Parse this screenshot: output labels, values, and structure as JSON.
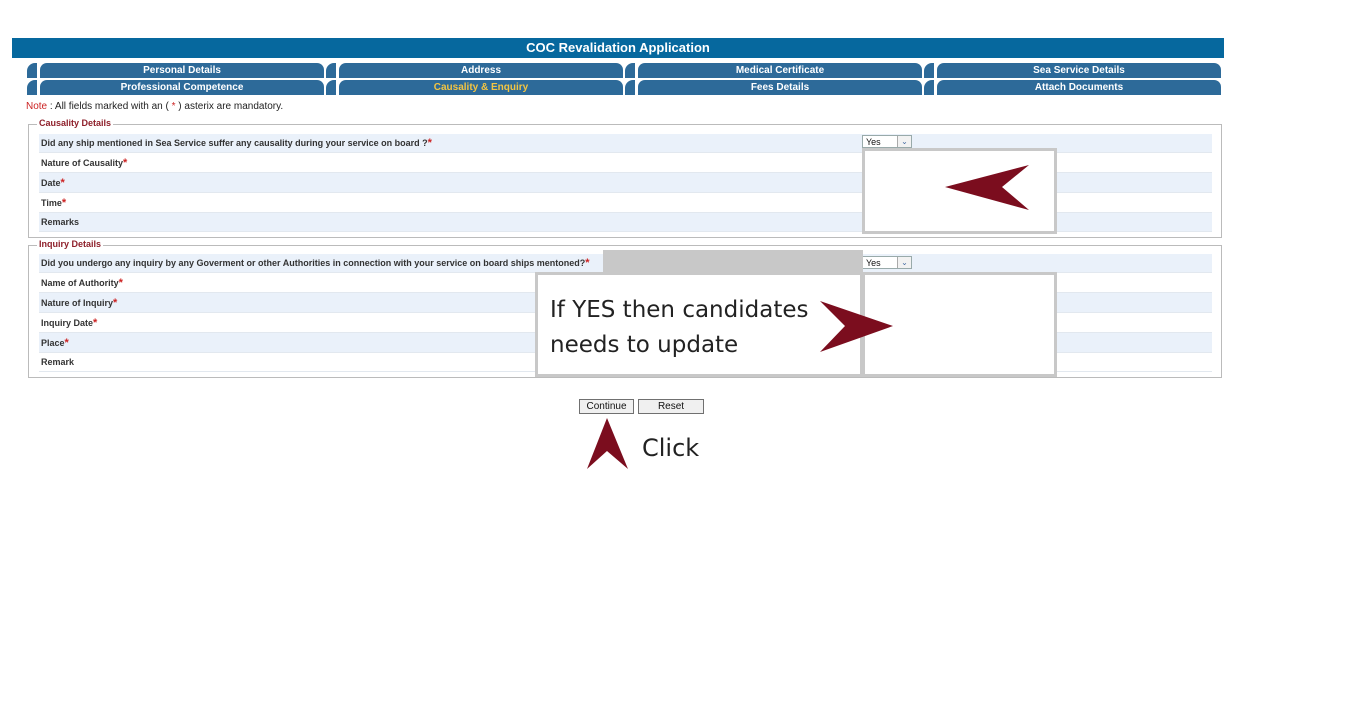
{
  "header": {
    "title": "COC Revalidation Application"
  },
  "tabs": [
    {
      "label": "Personal Details"
    },
    {
      "label": "Address"
    },
    {
      "label": "Medical Certificate"
    },
    {
      "label": "Sea Service Details"
    },
    {
      "label": "Professional Competence"
    },
    {
      "label": "Causality & Enquiry",
      "active": true
    },
    {
      "label": "Fees Details"
    },
    {
      "label": "Attach Documents"
    }
  ],
  "note": {
    "prefix": "Note",
    "text1": " : All fields marked with an ( ",
    "star": "*",
    "text2": " ) asterix are mandatory."
  },
  "causality": {
    "legend": "Causality Details",
    "question": "Did any ship mentioned in Sea Service suffer any causality during your service on board ?",
    "select_value": "Yes",
    "rows": [
      "Nature of Causality",
      "Date",
      "Time",
      "Remarks"
    ]
  },
  "inquiry": {
    "legend": "Inquiry Details",
    "question": "Did you undergo any inquiry by any Goverment or other Authorities in connection with your service on board ships mentoned?",
    "select_value": "Yes",
    "rows": [
      "Name of Authority",
      "Nature of Inquiry",
      "Inquiry Date",
      "Place",
      "Remark"
    ]
  },
  "callout": {
    "line1": "If YES then candidates",
    "line2": "needs to update"
  },
  "buttons": {
    "continue": "Continue",
    "reset": "Reset"
  },
  "click_label": "Click",
  "colors": {
    "header": "#06689e",
    "tab": "#2d6a99",
    "active_tab_text": "#f4c542",
    "arrow": "#7b0d1e",
    "required": "#cc2222"
  }
}
